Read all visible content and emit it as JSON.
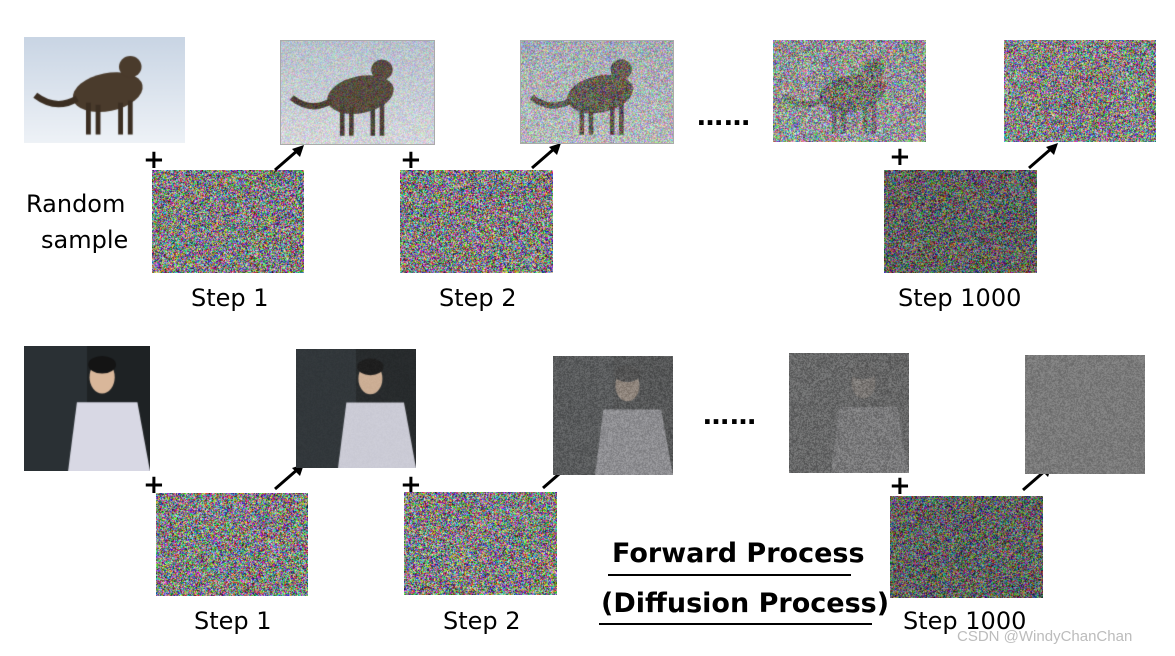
{
  "row1": {
    "side_label_line1": "Random",
    "side_label_line2": "sample",
    "source_image": "cat-photo",
    "steps": [
      {
        "label": "Step 1",
        "noise_level": 0.25
      },
      {
        "label": "Step 2",
        "noise_level": 0.5
      },
      {
        "label": "Step 1000",
        "noise_level": 1.0
      }
    ],
    "intermediate_noise_level": 0.8
  },
  "row2": {
    "source_image": "man-portrait-photo",
    "steps": [
      {
        "label": "Step 1",
        "noise_level": 0.15
      },
      {
        "label": "Step 2",
        "noise_level": 0.7
      },
      {
        "label": "Step 1000",
        "noise_level": 1.0
      }
    ],
    "intermediate_noise_level": 0.9
  },
  "plus_symbol": "+",
  "ellipsis": "……",
  "title_line1": "Forward Process",
  "title_line2": "(Diffusion Process)",
  "watermark": "CSDN @WindyChanChan",
  "colors": {
    "text": "#000000",
    "watermark": "#bcbcbc",
    "row2_noise_gray": "#7a7a7a"
  }
}
